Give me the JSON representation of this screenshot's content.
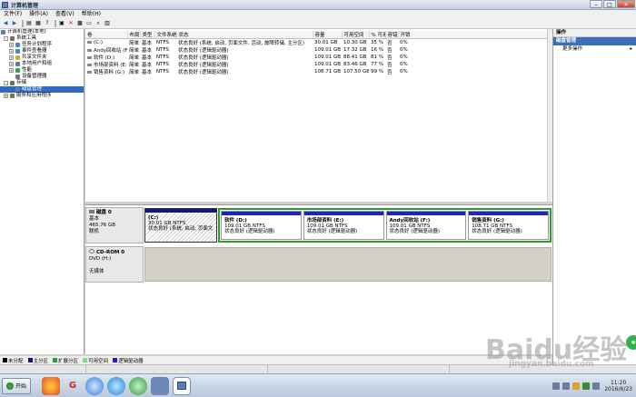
{
  "window": {
    "title": "计算机管理",
    "controls": {
      "minimize": "–",
      "maximize": "□",
      "close": "✕"
    }
  },
  "menu": [
    "文件(F)",
    "操作(A)",
    "查看(V)",
    "帮助(H)"
  ],
  "tree": {
    "root": "计算机管理(本地)",
    "items": [
      {
        "label": "系统工具",
        "level": 1,
        "exp": "-",
        "color": "#7a6e52"
      },
      {
        "label": "任务计划程序",
        "level": 2,
        "exp": "+",
        "color": "#4a86c8"
      },
      {
        "label": "事件查看器",
        "level": 2,
        "exp": "+",
        "color": "#4a86c8"
      },
      {
        "label": "共享文件夹",
        "level": 2,
        "exp": "+",
        "color": "#d9a63a"
      },
      {
        "label": "本地用户和组",
        "level": 2,
        "exp": "+",
        "color": "#5b7bb0"
      },
      {
        "label": "性能",
        "level": 2,
        "exp": "+",
        "color": "#3e9e4e"
      },
      {
        "label": "设备管理器",
        "level": 2,
        "exp": "",
        "color": "#6c7a8e"
      },
      {
        "label": "存储",
        "level": 1,
        "exp": "-",
        "color": "#7a6e52"
      },
      {
        "label": "磁盘管理",
        "level": 2,
        "exp": "",
        "color": "#5a7db5",
        "selected": true
      },
      {
        "label": "服务和应用程序",
        "level": 1,
        "exp": "+",
        "color": "#7a6e52"
      }
    ]
  },
  "columns": [
    "卷",
    "布局",
    "类型",
    "文件系统",
    "状态",
    "容量",
    "可用空间",
    "% 可用",
    "容错",
    "开销"
  ],
  "volumes": [
    [
      "(C:)",
      "简单",
      "基本",
      "NTFS",
      "状态良好 (系统, 启动, 页面文件, 活动, 故障转储, 主分区)",
      "30.01 GB",
      "10.30 GB",
      "35 %",
      "否",
      "0%"
    ],
    [
      "Andy回收站 (F:)",
      "简单",
      "基本",
      "NTFS",
      "状态良好 (逻辑驱动器)",
      "109.01 GB",
      "17.32 GB",
      "16 %",
      "否",
      "0%"
    ],
    [
      "软件 (D:)",
      "简单",
      "基本",
      "NTFS",
      "状态良好 (逻辑驱动器)",
      "109.01 GB",
      "88.41 GB",
      "81 %",
      "否",
      "0%"
    ],
    [
      "市场部资料 (E:)",
      "简单",
      "基本",
      "NTFS",
      "状态良好 (逻辑驱动器)",
      "109.01 GB",
      "83.46 GB",
      "77 %",
      "否",
      "0%"
    ],
    [
      "销售资料 (G:)",
      "简单",
      "基本",
      "NTFS",
      "状态良好 (逻辑驱动器)",
      "108.71 GB",
      "107.50 GB",
      "99 %",
      "否",
      "0%"
    ]
  ],
  "disk0": {
    "name": "磁盘 0",
    "type": "基本",
    "size": "465.76 GB",
    "status": "联机",
    "parts": [
      {
        "name": "(C:)",
        "size": "30.01 GB NTFS",
        "status": "状态良好 (系统, 启动, 页面文"
      },
      {
        "name": "软件  (D:)",
        "size": "109.01 GB NTFS",
        "status": "状态良好 (逻辑驱动器)"
      },
      {
        "name": "市场部资料  (E:)",
        "size": "109.01 GB NTFS",
        "status": "状态良好 (逻辑驱动器)"
      },
      {
        "name": "Andy回收站  (F:)",
        "size": "109.01 GB NTFS",
        "status": "状态良好 (逻辑驱动器)"
      },
      {
        "name": "销售资料  (G:)",
        "size": "108.71 GB NTFS",
        "status": "状态良好 (逻辑驱动器)"
      }
    ]
  },
  "cdrom": {
    "name": "CD-ROM 0",
    "type": "DVD (H:)",
    "status": "无媒体"
  },
  "legend": [
    {
      "label": "未分配",
      "color": "#000000"
    },
    {
      "label": "主分区",
      "color": "#15157a"
    },
    {
      "label": "扩展分区",
      "color": "#2c9c2c"
    },
    {
      "label": "可用空间",
      "color": "#7fe07f"
    },
    {
      "label": "逻辑驱动器",
      "color": "#2121c8"
    }
  ],
  "actions": {
    "header": "操作",
    "section": "磁盘管理",
    "more": "更多操作",
    "more_arrow": "▸"
  },
  "taskbar": {
    "start": "开始",
    "time": "11:20",
    "date": "2016/6/23"
  },
  "watermark": {
    "logo": "Baidu经验",
    "url": "jingyan.baidu.com"
  }
}
